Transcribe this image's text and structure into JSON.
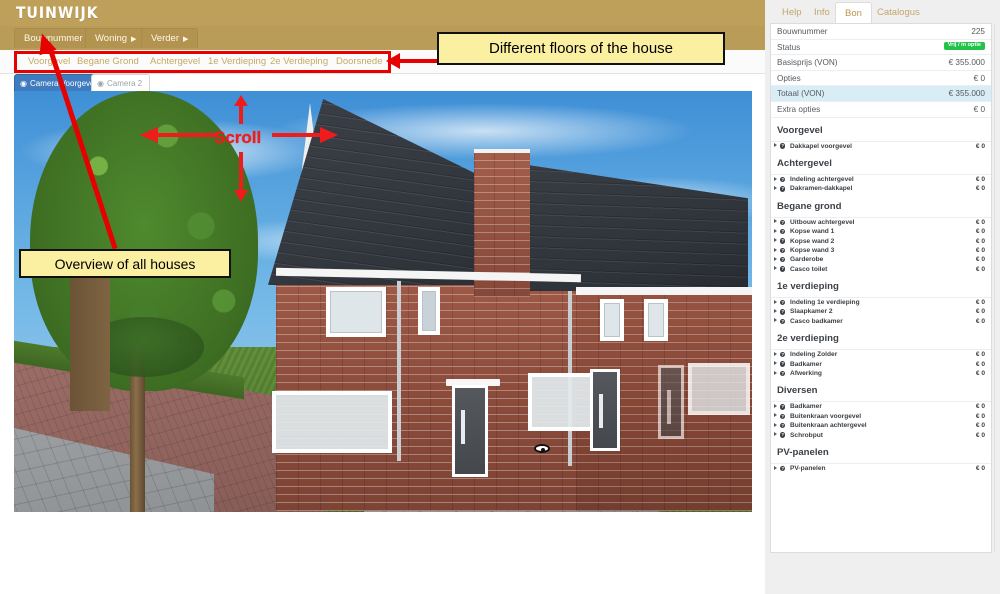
{
  "brand": {
    "name": "TUINWIJK"
  },
  "menu": {
    "items": [
      {
        "label": "Bouwnummer",
        "caret": "▶"
      },
      {
        "label": "Woning",
        "caret": "▶"
      },
      {
        "label": "Verder",
        "caret": "▶"
      }
    ]
  },
  "floors": {
    "tabs": [
      {
        "label": "Voorgevel",
        "active": true
      },
      {
        "label": "Begane Grond",
        "active": false
      },
      {
        "label": "Achtergevel",
        "active": false
      },
      {
        "label": "1e Verdieping",
        "active": false
      },
      {
        "label": "2e Verdieping",
        "active": false
      },
      {
        "label": "Doorsnede",
        "active": false
      }
    ]
  },
  "cameras": {
    "tabs": [
      {
        "label": "Camera Voorgevel",
        "icon": "eye-icon",
        "active": true
      },
      {
        "label": "Camera 2",
        "icon": "eye-icon",
        "active": false
      }
    ]
  },
  "annotations": {
    "floors_callout": "Different floors of the house",
    "overview_callout": "Overview of all houses",
    "scroll_label": "Scroll"
  },
  "sidebar": {
    "tabs": [
      {
        "label": "Help",
        "active": false
      },
      {
        "label": "Info",
        "active": false
      },
      {
        "label": "Bon",
        "active": true
      },
      {
        "label": "Catalogus",
        "active": false
      }
    ],
    "summary": [
      {
        "label": "Bouwnummer",
        "value": "225",
        "type": "text"
      },
      {
        "label": "Status",
        "value": "Vrij / in optie",
        "type": "badge",
        "color": "#23c24a"
      },
      {
        "label": "Basisprijs (VON)",
        "value": "€ 355.000",
        "type": "text"
      },
      {
        "label": "Opties",
        "value": "€ 0",
        "type": "text"
      },
      {
        "label": "Totaal (VON)",
        "value": "€ 355.000",
        "type": "total"
      },
      {
        "label": "Extra opties",
        "value": "€ 0",
        "type": "text"
      }
    ],
    "sections": [
      {
        "title": "Voorgevel",
        "options": [
          {
            "label": "Dakkapel voorgevel",
            "price": "€ 0"
          }
        ]
      },
      {
        "title": "Achtergevel",
        "options": [
          {
            "label": "Indeling achtergevel",
            "price": "€ 0"
          },
          {
            "label": "Dakramen-dakkapel",
            "price": "€ 0"
          }
        ]
      },
      {
        "title": "Begane grond",
        "options": [
          {
            "label": "Uitbouw achtergevel",
            "price": "€ 0"
          },
          {
            "label": "Kopse wand 1",
            "price": "€ 0"
          },
          {
            "label": "Kopse wand 2",
            "price": "€ 0"
          },
          {
            "label": "Kopse wand 3",
            "price": "€ 0"
          },
          {
            "label": "Garderobe",
            "price": "€ 0"
          },
          {
            "label": "Casco toilet",
            "price": "€ 0"
          }
        ]
      },
      {
        "title": "1e verdieping",
        "options": [
          {
            "label": "Indeling 1e verdieping",
            "price": "€ 0"
          },
          {
            "label": "Slaapkamer 2",
            "price": "€ 0"
          },
          {
            "label": "Casco badkamer",
            "price": "€ 0"
          }
        ]
      },
      {
        "title": "2e verdieping",
        "options": [
          {
            "label": "Indeling Zolder",
            "price": "€ 0"
          },
          {
            "label": "Badkamer",
            "price": "€ 0"
          },
          {
            "label": "Afwerking",
            "price": "€ 0"
          }
        ]
      },
      {
        "title": "Diversen",
        "options": [
          {
            "label": "Badkamer",
            "price": "€ 0"
          },
          {
            "label": "Buitenkraan voorgevel",
            "price": "€ 0"
          },
          {
            "label": "Buitenkraan achtergevel",
            "price": "€ 0"
          },
          {
            "label": "Schrobput",
            "price": "€ 0"
          }
        ]
      },
      {
        "title": "PV-panelen",
        "options": [
          {
            "label": "PV-panelen",
            "price": "€ 0"
          }
        ]
      }
    ]
  },
  "colors": {
    "brand_tan": "#bfa05a",
    "menu_tan": "#b99c57",
    "annotation_red": "#e60000",
    "callout_yellow": "#fbefa2",
    "status_green": "#23c24a",
    "camera_active_blue": "#3f7bbf"
  }
}
